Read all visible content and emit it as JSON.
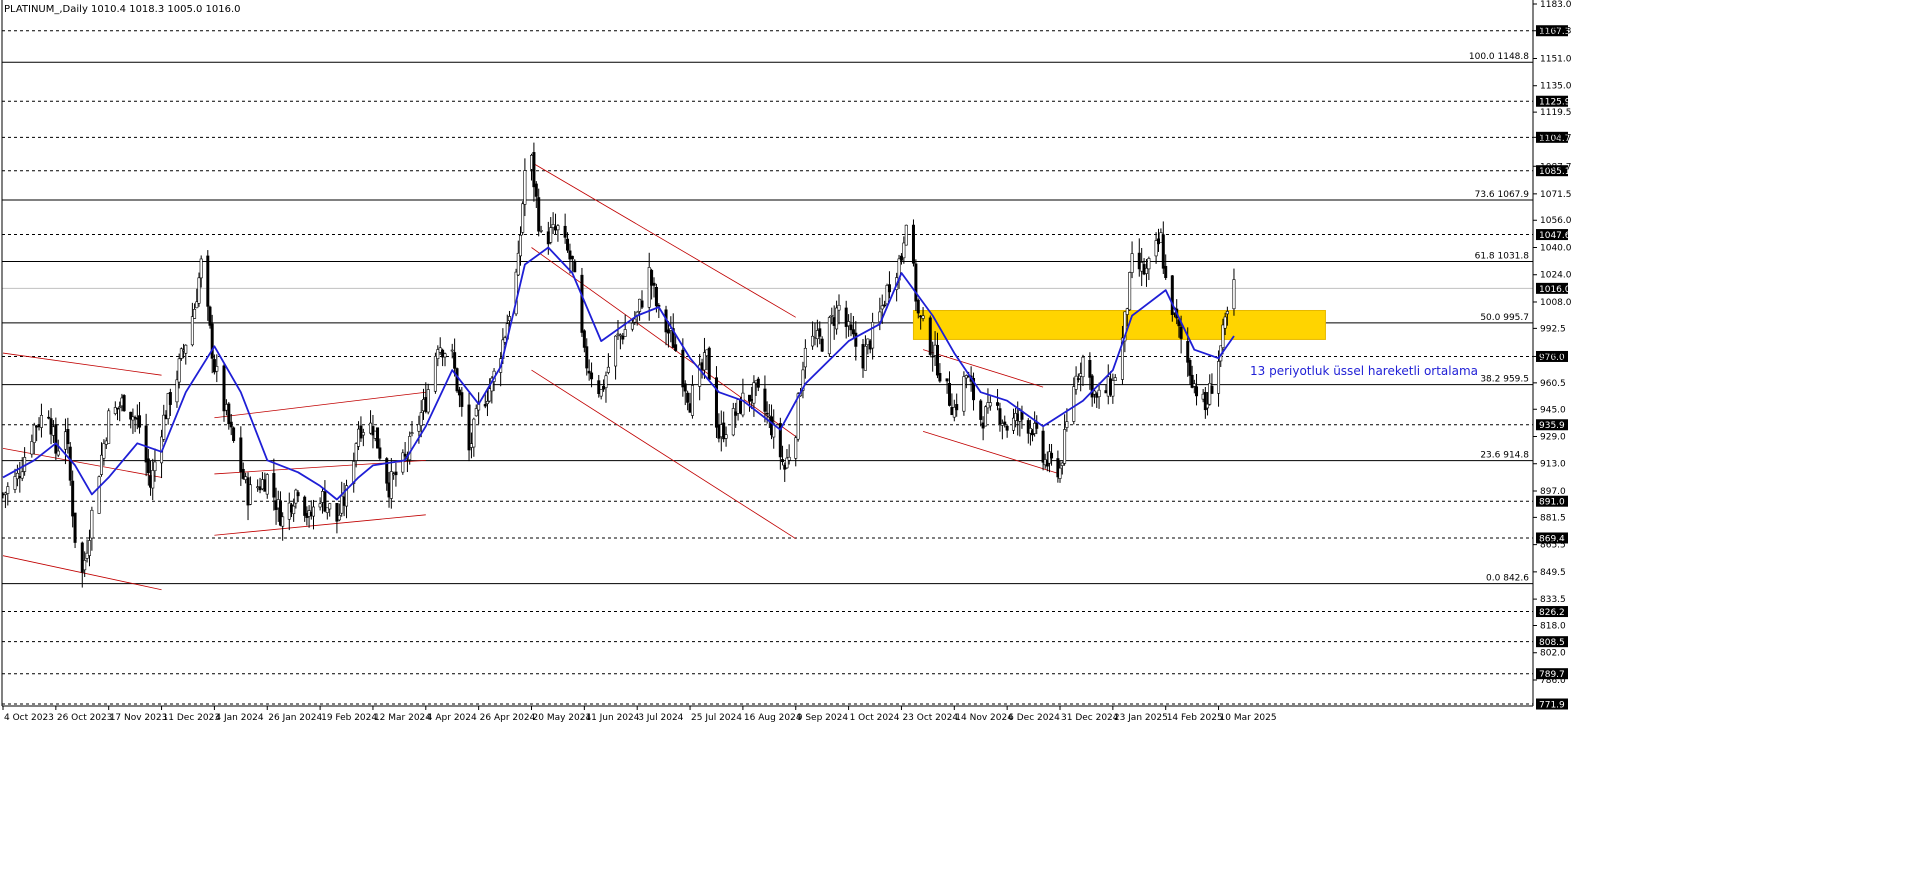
{
  "chart_data": {
    "type": "candlestick",
    "header": "PLATINUM_,Daily  1010.4 1018.3 1005.0 1016.0",
    "symbol": "PLATINUM_",
    "timeframe": "Daily",
    "ohlc_last": {
      "open": 1010.4,
      "high": 1018.3,
      "low": 1005.0,
      "close": 1016.0
    },
    "ylim": [
      771.9,
      1183.0
    ],
    "y_ticks": [
      1183.0,
      1167.3,
      1151.0,
      1135.0,
      1119.5,
      1104.7,
      1087.7,
      1071.5,
      1056.0,
      1040.0,
      1024.0,
      1008.0,
      992.5,
      976.0,
      960.5,
      945.0,
      929.0,
      913.0,
      897.0,
      881.5,
      865.5,
      849.5,
      833.5,
      818.0,
      802.0,
      786.0
    ],
    "x_labels": [
      "4 Oct 2023",
      "26 Oct 2023",
      "17 Nov 2023",
      "11 Dec 2023",
      "4 Jan 2024",
      "26 Jan 2024",
      "19 Feb 2024",
      "12 Mar 2024",
      "4 Apr 2024",
      "26 Apr 2024",
      "20 May 2024",
      "11 Jun 2024",
      "3 Jul 2024",
      "25 Jul 2024",
      "16 Aug 2024",
      "9 Sep 2024",
      "1 Oct 2024",
      "23 Oct 2024",
      "14 Nov 2024",
      "6 Dec 2024",
      "31 Dec 2024",
      "23 Jan 2025",
      "14 Feb 2025",
      "10 Mar 2025"
    ],
    "price_levels": [
      1167.3,
      1125.9,
      1104.7,
      1085.1,
      1047.6,
      976.0,
      935.9,
      891.0,
      869.4,
      826.2,
      808.5,
      789.7,
      771.9
    ],
    "current_price": 1016.0,
    "fibonacci_levels": [
      {
        "ratio": "100.0",
        "price": 1148.8
      },
      {
        "ratio": "73.6",
        "price": 1067.9
      },
      {
        "ratio": "61.8",
        "price": 1031.8
      },
      {
        "ratio": "50.0",
        "price": 995.7
      },
      {
        "ratio": "38.2",
        "price": 959.5
      },
      {
        "ratio": "23.6",
        "price": 914.8
      },
      {
        "ratio": "0.0",
        "price": 842.6
      }
    ],
    "ema_period": 13,
    "annotation": "13 periyotluk üssel hareketli ortalama",
    "support_zone": {
      "from_date": "23 Oct 2024",
      "to_date": "after 10 Mar 2025",
      "low": 986.0,
      "high": 1003.0
    },
    "close_anchors": [
      [
        "4 Oct 2023",
        895
      ],
      [
        "10 Oct 2023",
        905
      ],
      [
        "17 Oct 2023",
        935
      ],
      [
        "23 Oct 2023",
        945
      ],
      [
        "26 Oct 2023",
        920
      ],
      [
        "30 Oct 2023",
        935
      ],
      [
        "3 Nov 2023",
        870
      ],
      [
        "6 Nov 2023",
        848
      ],
      [
        "13 Nov 2023",
        910
      ],
      [
        "17 Nov 2023",
        940
      ],
      [
        "24 Nov 2023",
        950
      ],
      [
        "1 Dec 2023",
        935
      ],
      [
        "6 Dec 2023",
        900
      ],
      [
        "11 Dec 2023",
        935
      ],
      [
        "18 Dec 2023",
        965
      ],
      [
        "26 Dec 2023",
        1005
      ],
      [
        "29 Dec 2023",
        1030
      ],
      [
        "4 Jan 2024",
        970
      ],
      [
        "11 Jan 2024",
        930
      ],
      [
        "18 Jan 2024",
        895
      ],
      [
        "26 Jan 2024",
        905
      ],
      [
        "2 Feb 2024",
        880
      ],
      [
        "9 Feb 2024",
        900
      ],
      [
        "14 Feb 2024",
        880
      ],
      [
        "19 Feb 2024",
        895
      ],
      [
        "26 Feb 2024",
        880
      ],
      [
        "1 Mar 2024",
        895
      ],
      [
        "6 Mar 2024",
        935
      ],
      [
        "12 Mar 2024",
        935
      ],
      [
        "19 Mar 2024",
        900
      ],
      [
        "26 Mar 2024",
        915
      ],
      [
        "4 Apr 2024",
        950
      ],
      [
        "9 Apr 2024",
        985
      ],
      [
        "15 Apr 2024",
        975
      ],
      [
        "22 Apr 2024",
        920
      ],
      [
        "26 Apr 2024",
        945
      ],
      [
        "2 May 2024",
        960
      ],
      [
        "8 May 2024",
        990
      ],
      [
        "14 May 2024",
        1030
      ],
      [
        "17 May 2024",
        1085
      ],
      [
        "20 May 2024",
        1090
      ],
      [
        "24 May 2024",
        1045
      ],
      [
        "31 May 2024",
        1050
      ],
      [
        "6 Jun 2024",
        1030
      ],
      [
        "11 Jun 2024",
        975
      ],
      [
        "18 Jun 2024",
        955
      ],
      [
        "24 Jun 2024",
        985
      ],
      [
        "3 Jul 2024",
        1000
      ],
      [
        "8 Jul 2024",
        1025
      ],
      [
        "12 Jul 2024",
        1000
      ],
      [
        "18 Jul 2024",
        985
      ],
      [
        "25 Jul 2024",
        950
      ],
      [
        "1 Aug 2024",
        975
      ],
      [
        "6 Aug 2024",
        930
      ],
      [
        "12 Aug 2024",
        940
      ],
      [
        "16 Aug 2024",
        950
      ],
      [
        "22 Aug 2024",
        955
      ],
      [
        "29 Aug 2024",
        935
      ],
      [
        "4 Sep 2024",
        910
      ],
      [
        "9 Sep 2024",
        935
      ],
      [
        "13 Sep 2024",
        985
      ],
      [
        "20 Sep 2024",
        985
      ],
      [
        "27 Sep 2024",
        1005
      ],
      [
        "1 Oct 2024",
        990
      ],
      [
        "7 Oct 2024",
        975
      ],
      [
        "14 Oct 2024",
        1000
      ],
      [
        "18 Oct 2024",
        1020
      ],
      [
        "23 Oct 2024",
        1035
      ],
      [
        "25 Oct 2024",
        1060
      ],
      [
        "30 Oct 2024",
        1000
      ],
      [
        "5 Nov 2024",
        980
      ],
      [
        "11 Nov 2024",
        955
      ],
      [
        "14 Nov 2024",
        945
      ],
      [
        "19 Nov 2024",
        965
      ],
      [
        "25 Nov 2024",
        940
      ],
      [
        "2 Dec 2024",
        945
      ],
      [
        "6 Dec 2024",
        935
      ],
      [
        "12 Dec 2024",
        940
      ],
      [
        "18 Dec 2024",
        935
      ],
      [
        "23 Dec 2024",
        915
      ],
      [
        "31 Dec 2024",
        910
      ],
      [
        "6 Jan 2025",
        960
      ],
      [
        "10 Jan 2025",
        975
      ],
      [
        "16 Jan 2025",
        950
      ],
      [
        "23 Jan 2025",
        960
      ],
      [
        "27 Jan 2025",
        985
      ],
      [
        "31 Jan 2025",
        1030
      ],
      [
        "6 Feb 2025",
        1025
      ],
      [
        "12 Feb 2025",
        1045
      ],
      [
        "14 Feb 2025",
        1020
      ],
      [
        "20 Feb 2025",
        990
      ],
      [
        "27 Feb 2025",
        960
      ],
      [
        "4 Mar 2025",
        945
      ],
      [
        "10 Mar 2025",
        975
      ],
      [
        "14 Mar 2025",
        1000
      ],
      [
        "17 Mar 2025",
        1016
      ]
    ],
    "ema_anchors": [
      [
        "4 Oct 2023",
        905
      ],
      [
        "17 Oct 2023",
        915
      ],
      [
        "26 Oct 2023",
        925
      ],
      [
        "3 Nov 2023",
        912
      ],
      [
        "10 Nov 2023",
        895
      ],
      [
        "17 Nov 2023",
        905
      ],
      [
        "30 Nov 2023",
        925
      ],
      [
        "11 Dec 2023",
        920
      ],
      [
        "22 Dec 2023",
        955
      ],
      [
        "4 Jan 2024",
        982
      ],
      [
        "15 Jan 2024",
        955
      ],
      [
        "26 Jan 2024",
        915
      ],
      [
        "9 Feb 2024",
        908
      ],
      [
        "19 Feb 2024",
        900
      ],
      [
        "26 Feb 2024",
        892
      ],
      [
        "6 Mar 2024",
        905
      ],
      [
        "12 Mar 2024",
        912
      ],
      [
        "26 Mar 2024",
        915
      ],
      [
        "4 Apr 2024",
        935
      ],
      [
        "15 Apr 2024",
        968
      ],
      [
        "26 Apr 2024",
        948
      ],
      [
        "6 May 2024",
        970
      ],
      [
        "17 May 2024",
        1030
      ],
      [
        "27 May 2024",
        1040
      ],
      [
        "6 Jun 2024",
        1025
      ],
      [
        "18 Jun 2024",
        985
      ],
      [
        "3 Jul 2024",
        1000
      ],
      [
        "12 Jul 2024",
        1005
      ],
      [
        "25 Jul 2024",
        975
      ],
      [
        "6 Aug 2024",
        955
      ],
      [
        "16 Aug 2024",
        950
      ],
      [
        "2 Sep 2024",
        933
      ],
      [
        "13 Sep 2024",
        960
      ],
      [
        "1 Oct 2024",
        985
      ],
      [
        "14 Oct 2024",
        995
      ],
      [
        "23 Oct 2024",
        1025
      ],
      [
        "5 Nov 2024",
        1000
      ],
      [
        "14 Nov 2024",
        978
      ],
      [
        "25 Nov 2024",
        955
      ],
      [
        "6 Dec 2024",
        950
      ],
      [
        "23 Dec 2024",
        935
      ],
      [
        "10 Jan 2025",
        950
      ],
      [
        "23 Jan 2025",
        968
      ],
      [
        "31 Jan 2025",
        1000
      ],
      [
        "14 Feb 2025",
        1015
      ],
      [
        "27 Feb 2025",
        980
      ],
      [
        "10 Mar 2025",
        975
      ],
      [
        "17 Mar 2025",
        988
      ]
    ],
    "trend_lines": [
      {
        "from": [
          "4 Oct 2023",
          978
        ],
        "to": [
          "11 Dec 2023",
          965
        ]
      },
      {
        "from": [
          "4 Oct 2023",
          922
        ],
        "to": [
          "11 Dec 2023",
          905
        ]
      },
      {
        "from": [
          "4 Oct 2023",
          859
        ],
        "to": [
          "11 Dec 2023",
          839
        ]
      },
      {
        "from": [
          "4 Jan 2024",
          940
        ],
        "to": [
          "4 Apr 2024",
          955
        ]
      },
      {
        "from": [
          "4 Jan 2024",
          907
        ],
        "to": [
          "4 Apr 2024",
          915
        ]
      },
      {
        "from": [
          "4 Jan 2024",
          871
        ],
        "to": [
          "4 Apr 2024",
          883
        ]
      },
      {
        "from": [
          "20 May 2024",
          1090
        ],
        "to": [
          "9 Sep 2024",
          999
        ]
      },
      {
        "from": [
          "20 May 2024",
          1040
        ],
        "to": [
          "9 Sep 2024",
          929
        ]
      },
      {
        "from": [
          "20 May 2024",
          968
        ],
        "to": [
          "9 Sep 2024",
          869
        ]
      },
      {
        "from": [
          "1 Nov 2024",
          980
        ],
        "to": [
          "23 Dec 2024",
          958
        ]
      },
      {
        "from": [
          "1 Nov 2024",
          932
        ],
        "to": [
          "31 Dec 2024",
          907
        ]
      }
    ]
  }
}
